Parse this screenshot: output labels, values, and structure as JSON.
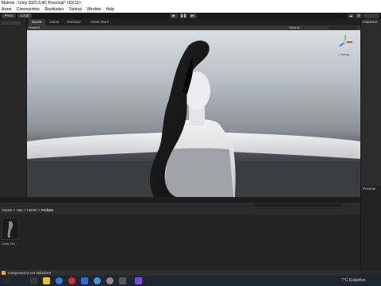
{
  "window": {
    "title": "Malone - Unity 2020.3.4f1 Personal* <DX12>"
  },
  "menu": {
    "items": [
      "Asset",
      "Cinemachine",
      "Realtusion",
      "Tutorial",
      "Window",
      "Help"
    ]
  },
  "toolbar": {
    "pivot_label": "Pivot",
    "local_label": "Local"
  },
  "scene_tabs": [
    {
      "label": "Scene",
      "active": true
    },
    {
      "label": "Game",
      "active": false
    },
    {
      "label": "Animator",
      "active": false
    },
    {
      "label": "Asset Store",
      "active": false
    }
  ],
  "scene_toolbar": {
    "shading_label": "Shaded",
    "gizmos_label": "Gizmos",
    "persp_label": "< Persp"
  },
  "inspector": {
    "title": "Inspector"
  },
  "preview": {
    "title": "Preview"
  },
  "project": {
    "breadcrumb": [
      "Assets",
      "Hair",
      "hair06",
      "Prefabs"
    ],
    "asset_label": "Unity_Ha..."
  },
  "status": {
    "message": "component is not initialized"
  },
  "tray": {
    "weather": "7°C",
    "weather_label": "Eclairées"
  },
  "colors": {
    "accent": "#3a72c4",
    "editor_bg": "#282828"
  }
}
